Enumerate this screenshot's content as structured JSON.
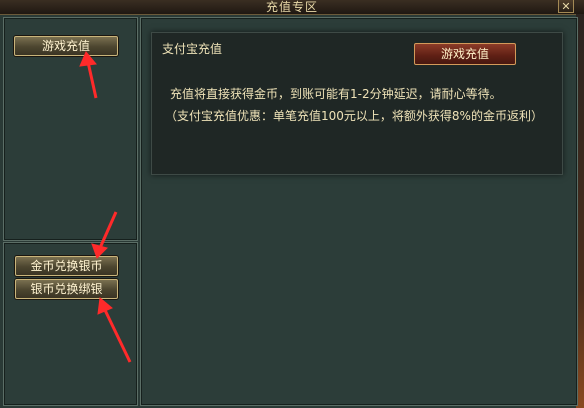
{
  "window": {
    "title": "充值专区"
  },
  "left_top": {
    "game_recharge_label": "游戏充值"
  },
  "left_bottom": {
    "gold_to_silver_label": "金币兑换银币",
    "silver_to_bind_label": "银币兑换绑银"
  },
  "main": {
    "heading": "支付宝充值",
    "recharge_button_label": "游戏充值",
    "line1": "充值将直接获得金币，到账可能有1-2分钟延迟，请耐心等待。",
    "line2": "（支付宝充值优惠：单笔充值100元以上，将额外获得8%的金币返利）"
  },
  "annotation": {
    "arrow_color": "#ff2a2a"
  }
}
